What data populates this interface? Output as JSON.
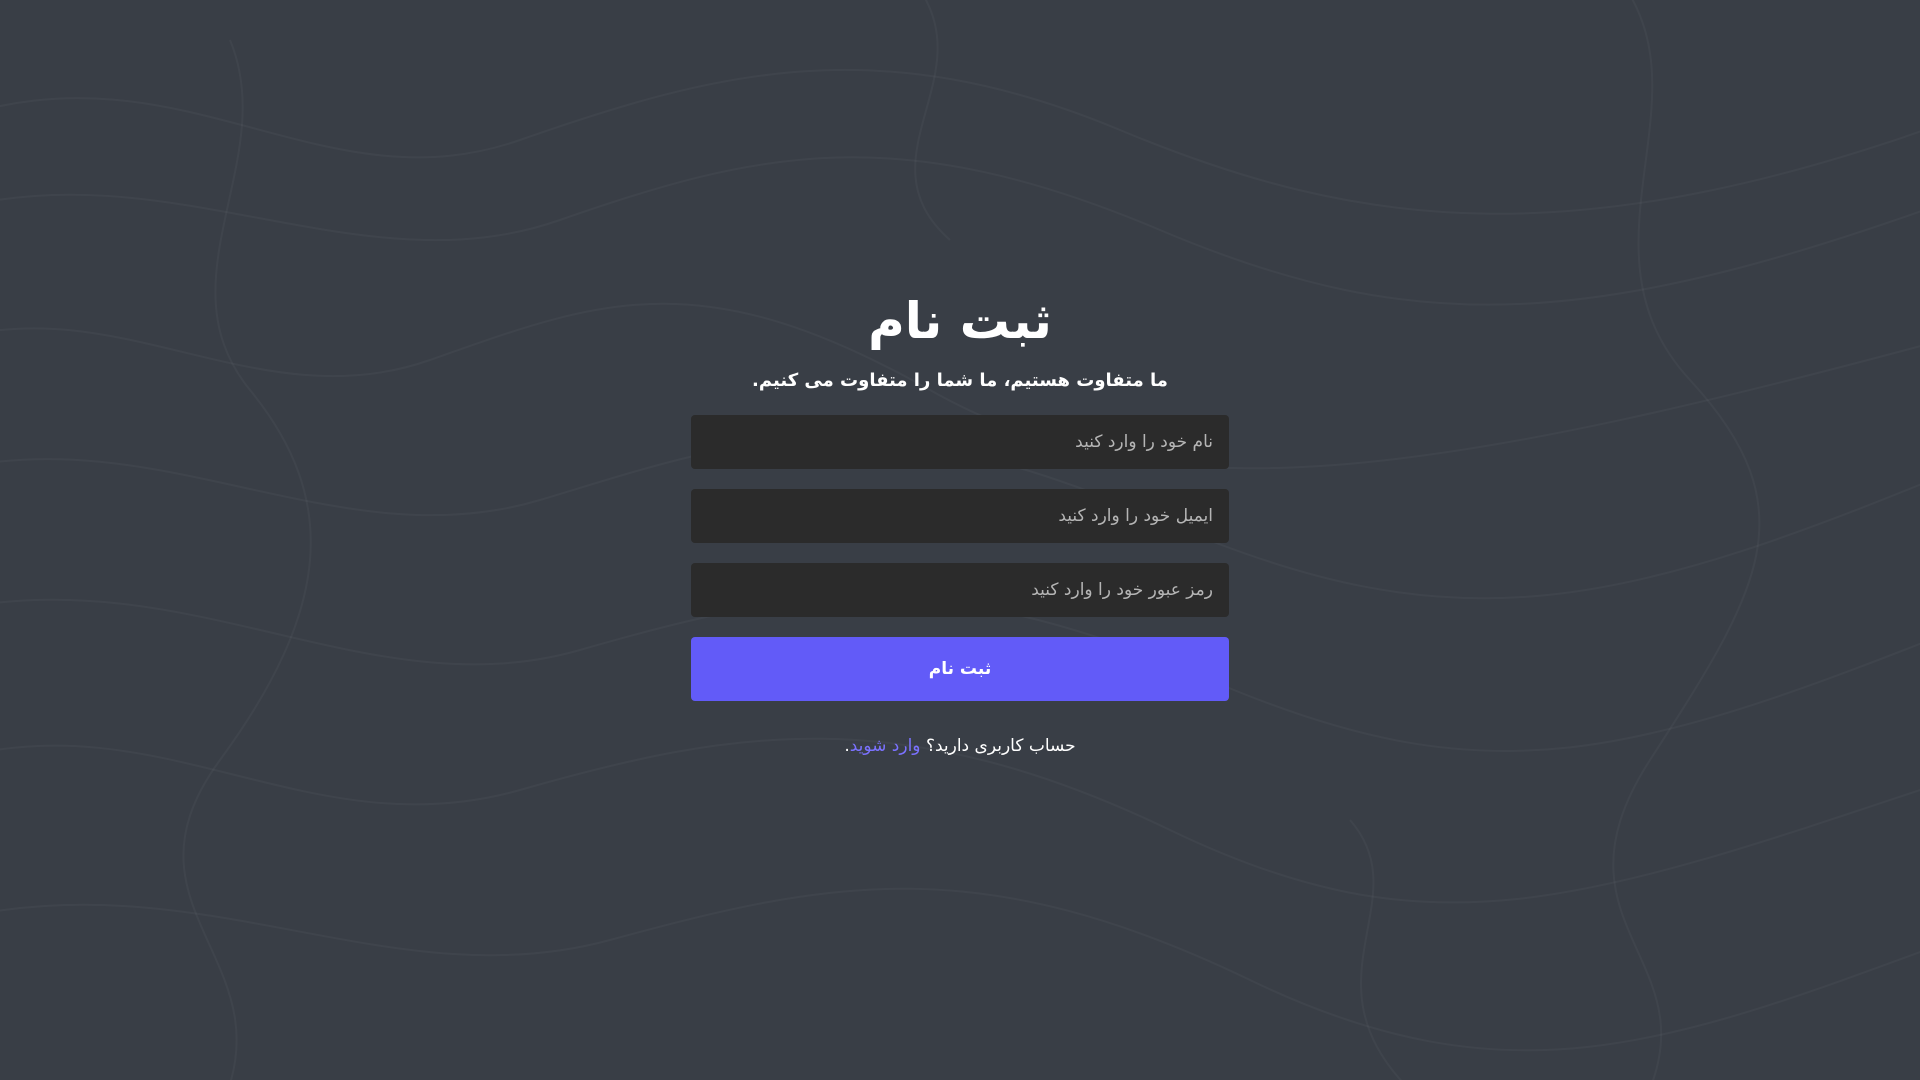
{
  "header": {
    "title": "ثبت نام",
    "subtitle": "ما متفاوت هستیم، ما شما را متفاوت می کنیم."
  },
  "form": {
    "name_placeholder": "نام خود را وارد کنید",
    "email_placeholder": "ایمیل خود را وارد کنید",
    "password_placeholder": "رمز عبور خود را وارد کنید",
    "submit_label": "ثبت نام"
  },
  "footer": {
    "question_text": "حساب کاربری دارید؟",
    "login_link_text": "وارد شوید",
    "period": "."
  },
  "colors": {
    "background": "#393e46",
    "field_background": "#2b2b2b",
    "accent": "#625bf8",
    "link": "#7b72ff"
  }
}
